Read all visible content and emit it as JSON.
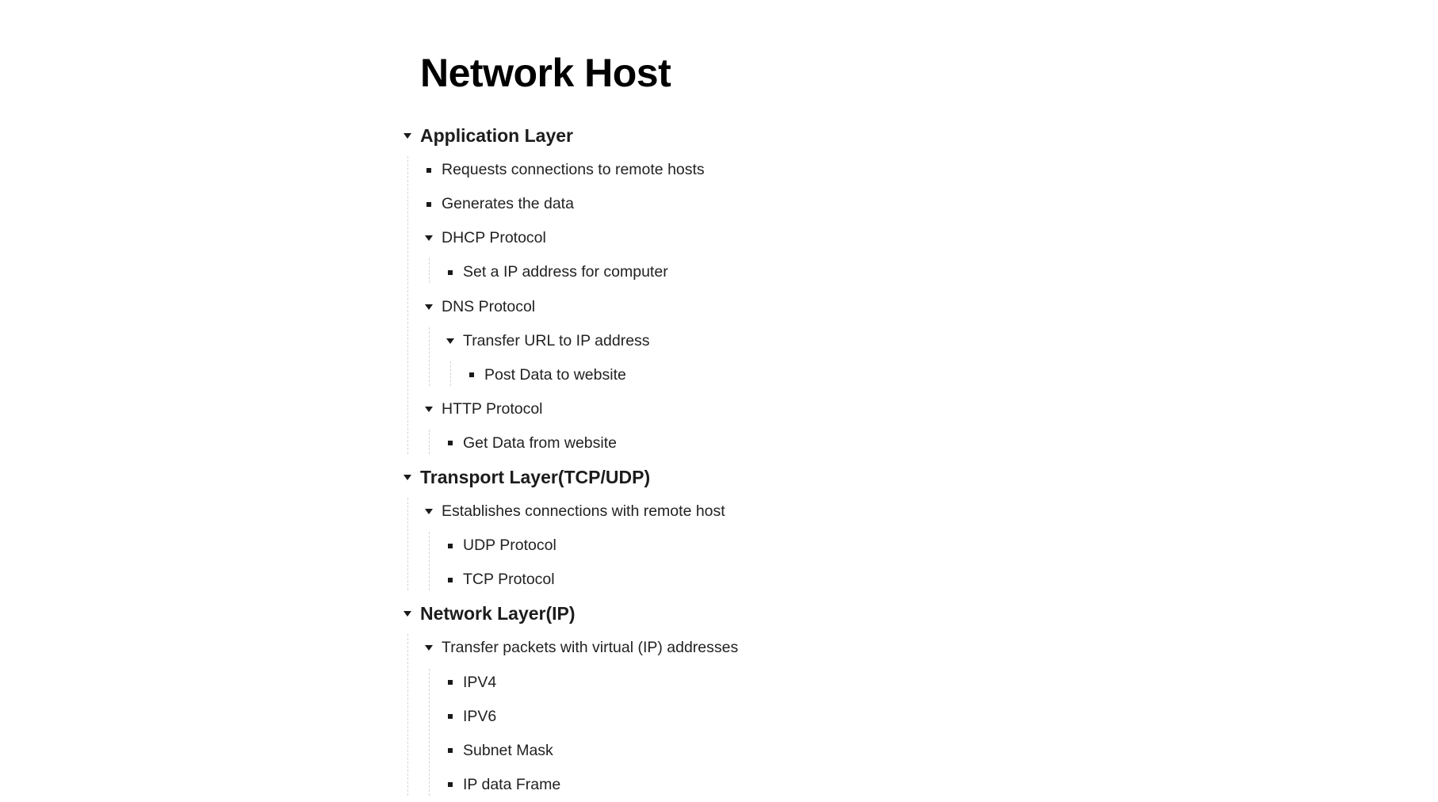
{
  "document": {
    "title": "Network Host"
  },
  "outline": [
    {
      "label": "Application Layer",
      "expanded": true,
      "children": [
        {
          "label": "Requests connections to remote hosts"
        },
        {
          "label": "Generates the data"
        },
        {
          "label": "DHCP Protocol",
          "expanded": true,
          "children": [
            {
              "label": "Set a IP address for computer"
            }
          ]
        },
        {
          "label": "DNS Protocol",
          "expanded": true,
          "children": [
            {
              "label": "Transfer URL to IP address",
              "expanded": true,
              "children": [
                {
                  "label": "Post Data to website"
                }
              ]
            }
          ]
        },
        {
          "label": "HTTP Protocol",
          "expanded": true,
          "children": [
            {
              "label": "Get Data from website"
            }
          ]
        }
      ]
    },
    {
      "label": "Transport Layer(TCP/UDP)",
      "expanded": true,
      "children": [
        {
          "label": "Establishes connections with remote host",
          "expanded": true,
          "children": [
            {
              "label": "UDP Protocol"
            },
            {
              "label": "TCP Protocol"
            }
          ]
        }
      ]
    },
    {
      "label": "Network Layer(IP)",
      "expanded": true,
      "children": [
        {
          "label": "Transfer packets with virtual (IP) addresses",
          "expanded": true,
          "children": [
            {
              "label": "IPV4"
            },
            {
              "label": "IPV6"
            },
            {
              "label": "Subnet  Mask"
            },
            {
              "label": "IP data Frame"
            }
          ]
        }
      ]
    }
  ],
  "icons": {
    "expanded": "triangle-down-icon",
    "leaf": "square-bullet-icon"
  }
}
